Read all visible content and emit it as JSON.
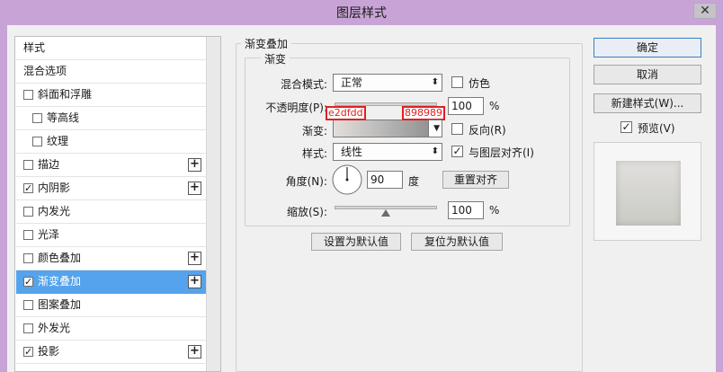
{
  "window": {
    "title": "图层样式",
    "close_label": "✕"
  },
  "style_list": {
    "items": [
      {
        "label": "样式",
        "checkbox": false,
        "checked": false,
        "plus": false,
        "indent": 0,
        "selected": false
      },
      {
        "label": "混合选项",
        "checkbox": false,
        "checked": false,
        "plus": false,
        "indent": 0,
        "selected": false
      },
      {
        "label": "斜面和浮雕",
        "checkbox": true,
        "checked": false,
        "plus": false,
        "indent": 0,
        "selected": false
      },
      {
        "label": "等高线",
        "checkbox": true,
        "checked": false,
        "plus": false,
        "indent": 1,
        "selected": false
      },
      {
        "label": "纹理",
        "checkbox": true,
        "checked": false,
        "plus": false,
        "indent": 1,
        "selected": false
      },
      {
        "label": "描边",
        "checkbox": true,
        "checked": false,
        "plus": true,
        "indent": 0,
        "selected": false
      },
      {
        "label": "内阴影",
        "checkbox": true,
        "checked": true,
        "plus": true,
        "indent": 0,
        "selected": false
      },
      {
        "label": "内发光",
        "checkbox": true,
        "checked": false,
        "plus": false,
        "indent": 0,
        "selected": false
      },
      {
        "label": "光泽",
        "checkbox": true,
        "checked": false,
        "plus": false,
        "indent": 0,
        "selected": false
      },
      {
        "label": "颜色叠加",
        "checkbox": true,
        "checked": false,
        "plus": true,
        "indent": 0,
        "selected": false
      },
      {
        "label": "渐变叠加",
        "checkbox": true,
        "checked": true,
        "plus": true,
        "indent": 0,
        "selected": true
      },
      {
        "label": "图案叠加",
        "checkbox": true,
        "checked": false,
        "plus": false,
        "indent": 0,
        "selected": false
      },
      {
        "label": "外发光",
        "checkbox": true,
        "checked": false,
        "plus": false,
        "indent": 0,
        "selected": false
      },
      {
        "label": "投影",
        "checkbox": true,
        "checked": true,
        "plus": true,
        "indent": 0,
        "selected": false
      }
    ]
  },
  "gradient_overlay": {
    "section_title": "渐变叠加",
    "group_title": "渐变",
    "blend_mode_label": "混合模式:",
    "blend_mode_value": "正常",
    "dither_label": "仿色",
    "dither_checked": false,
    "opacity_label": "不透明度(P):",
    "opacity_value": "100",
    "opacity_unit": "%",
    "opacity_level": 1.0,
    "gradient_label": "渐变:",
    "gradient_start_color": "#e2dfdd",
    "gradient_end_color": "#898989",
    "gradient_start_tag": "e2dfdd",
    "gradient_end_tag": "898989",
    "reverse_label": "反向(R)",
    "reverse_checked": false,
    "style_label": "样式:",
    "style_value": "线性",
    "align_label": "与图层对齐(I)",
    "align_checked": true,
    "angle_label": "角度(N):",
    "angle_value": "90",
    "angle_unit": "度",
    "reset_align_label": "重置对齐",
    "scale_label": "缩放(S):",
    "scale_value": "100",
    "scale_unit": "%",
    "scale_level": 0.5,
    "set_default_label": "设置为默认值",
    "reset_default_label": "复位为默认值"
  },
  "right_panel": {
    "ok_label": "确定",
    "cancel_label": "取消",
    "new_style_label": "新建样式(W)...",
    "preview_label": "预览(V)",
    "preview_checked": true
  },
  "colors": {
    "title_bar": "#c8a4d6",
    "selected_row": "#55a3ec",
    "annotation_red": "#e02020"
  }
}
